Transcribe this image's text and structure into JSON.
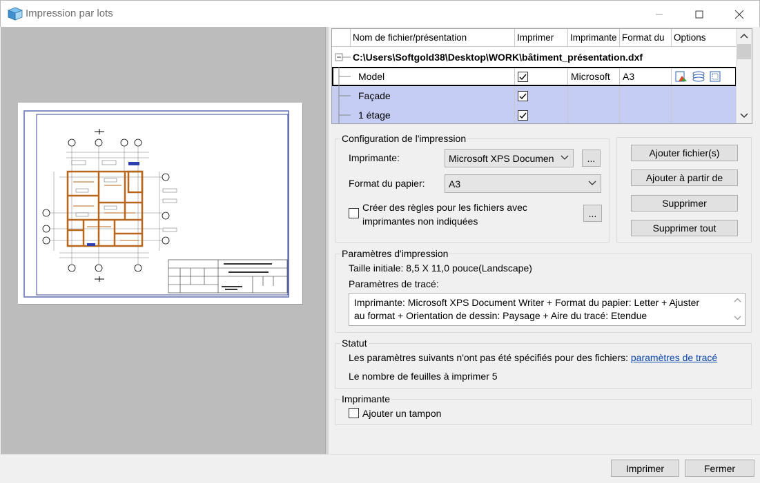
{
  "window": {
    "title": "Impression par lots",
    "icon": "batch-print-icon"
  },
  "grid": {
    "columns": [
      "Nom de fichier/présentation",
      "Imprimer",
      "Imprimante",
      "Format du",
      "Options"
    ],
    "file_path": "C:\\Users\\Softgold38\\Desktop\\WORK\\bâtiment_présentation.dxf",
    "rows": [
      {
        "name": "Model",
        "print": true,
        "printer": "Microsoft",
        "format": "A3",
        "selected": false,
        "focused": true
      },
      {
        "name": "Façade",
        "print": true,
        "printer": "",
        "format": "",
        "selected": true,
        "focused": false
      },
      {
        "name": "1 étage",
        "print": true,
        "printer": "",
        "format": "",
        "selected": true,
        "focused": false
      }
    ]
  },
  "config": {
    "title": "Configuration de l'impression",
    "printer_label": "Imprimante:",
    "printer_value": "Microsoft XPS Documen",
    "paper_label": "Format du papier:",
    "paper_value": "A3",
    "browse": "...",
    "rules_line1": "Créer des règles pour les fichiers avec",
    "rules_line2": "imprimantes non indiquées",
    "rules_checked": false
  },
  "actions": {
    "add_files": "Ajouter fichier(s)",
    "add_from": "Ajouter à partir de",
    "delete": "Supprimer",
    "delete_all": "Supprimer tout"
  },
  "params": {
    "title": "Paramètres d'impression",
    "initial_size": "Taille initiale: 8,5 X 11,0 pouce(Landscape)",
    "plot_label": "Paramètres de tracé:",
    "plot_line1": "Imprimante: Microsoft XPS Document Writer + Format du papier: Letter + Ajuster",
    "plot_line2": "au format + Orientation de dessin: Paysage + Aire du tracé: Etendue"
  },
  "status": {
    "title": "Statut",
    "message": "Les paramètres suivants n'ont pas été spécifiés pour des fichiers:",
    "link": "paramètres de tracé",
    "sheets": "Le nombre de feuilles à imprimer 5"
  },
  "stamp": {
    "title": "Imprimante",
    "add_stamp": "Ajouter un tampon",
    "checked": false
  },
  "footer": {
    "print": "Imprimer",
    "close": "Fermer"
  },
  "colors": {
    "selected_row": "#c5cdf5",
    "preview_bg": "#bcbcbc",
    "sheet_border": "#5a6ab0",
    "walls": "#b8661a",
    "link": "#0645ad"
  }
}
